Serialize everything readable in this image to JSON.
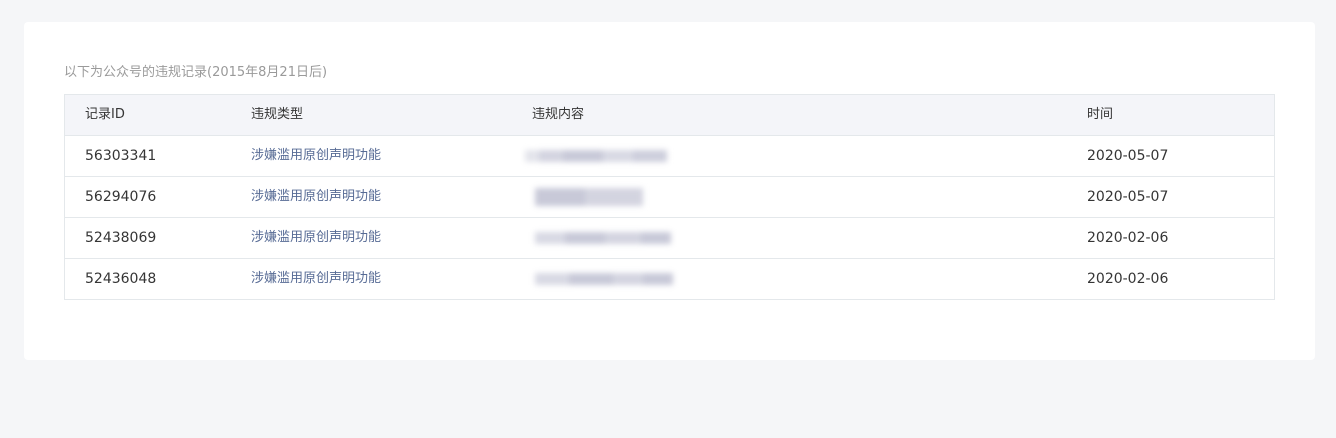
{
  "caption": "以下为公众号的违规记录(2015年8月21日后)",
  "table": {
    "headers": {
      "id": "记录ID",
      "type": "违规类型",
      "content": "违规内容",
      "time": "时间"
    },
    "rows": [
      {
        "id": "56303341",
        "type": "涉嫌滥用原创声明功能",
        "content": "[blurred]",
        "time": "2020-05-07"
      },
      {
        "id": "56294076",
        "type": "涉嫌滥用原创声明功能",
        "content": "[blurred]",
        "time": "2020-05-07"
      },
      {
        "id": "52438069",
        "type": "涉嫌滥用原创声明功能",
        "content": "[blurred]",
        "time": "2020-02-06"
      },
      {
        "id": "52436048",
        "type": "涉嫌滥用原创声明功能",
        "content": "[blurred]",
        "time": "2020-02-06"
      }
    ]
  },
  "colors": {
    "link": "#576b95",
    "header_bg": "#f4f5f9",
    "page_bg": "#f5f6f8",
    "border": "#e4e8eb"
  }
}
